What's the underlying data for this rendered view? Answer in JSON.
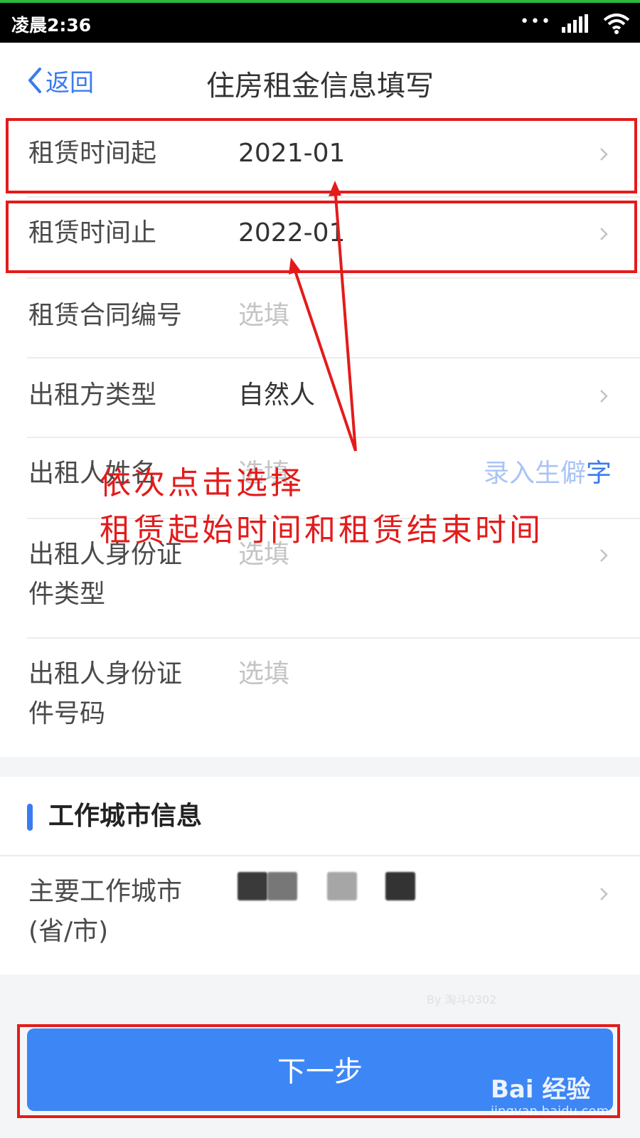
{
  "status_bar": {
    "time": "凌晨2:36",
    "icons": [
      "more-dots-icon",
      "signal-icon",
      "wifi-icon"
    ]
  },
  "nav": {
    "back_label": "返回",
    "title": "住房租金信息填写"
  },
  "form": {
    "rows": [
      {
        "label": "租赁时间起",
        "value": "2021-01",
        "placeholder": false,
        "chevron": true
      },
      {
        "label": "租赁时间止",
        "value": "2022-01",
        "placeholder": false,
        "chevron": true
      },
      {
        "label": "租赁合同编号",
        "value": "选填",
        "placeholder": true,
        "chevron": false
      },
      {
        "label": "出租方类型",
        "value": "自然人",
        "placeholder": false,
        "chevron": true
      },
      {
        "label": "出租人姓名",
        "value": "选填",
        "placeholder": true,
        "side_link": "录入生僻字"
      },
      {
        "label_line1": "出租人身份证",
        "label_line2": "件类型",
        "value": "选填",
        "placeholder": true,
        "chevron": true
      },
      {
        "label_line1": "出租人身份证",
        "label_line2": "件号码",
        "value": "选填",
        "placeholder": true,
        "chevron": false
      }
    ]
  },
  "work_city": {
    "section_title": "工作城市信息",
    "label_line1": "主要工作城市",
    "label_line2": "(省/市)",
    "value_obscured": true
  },
  "next_button": {
    "label": "下一步"
  },
  "annotation": {
    "line1": "依次点击选择",
    "line2": "租赁起始时间和租赁结束时间"
  },
  "watermark": {
    "author": "By 淘斗0302",
    "logo_text": "Bai 经验",
    "url": "jingyan.baidu.com"
  },
  "colors": {
    "accent": "#3a7bf0",
    "button": "#3d86f5",
    "annotation_red": "#e31b1b",
    "placeholder": "#c4c4c4"
  }
}
